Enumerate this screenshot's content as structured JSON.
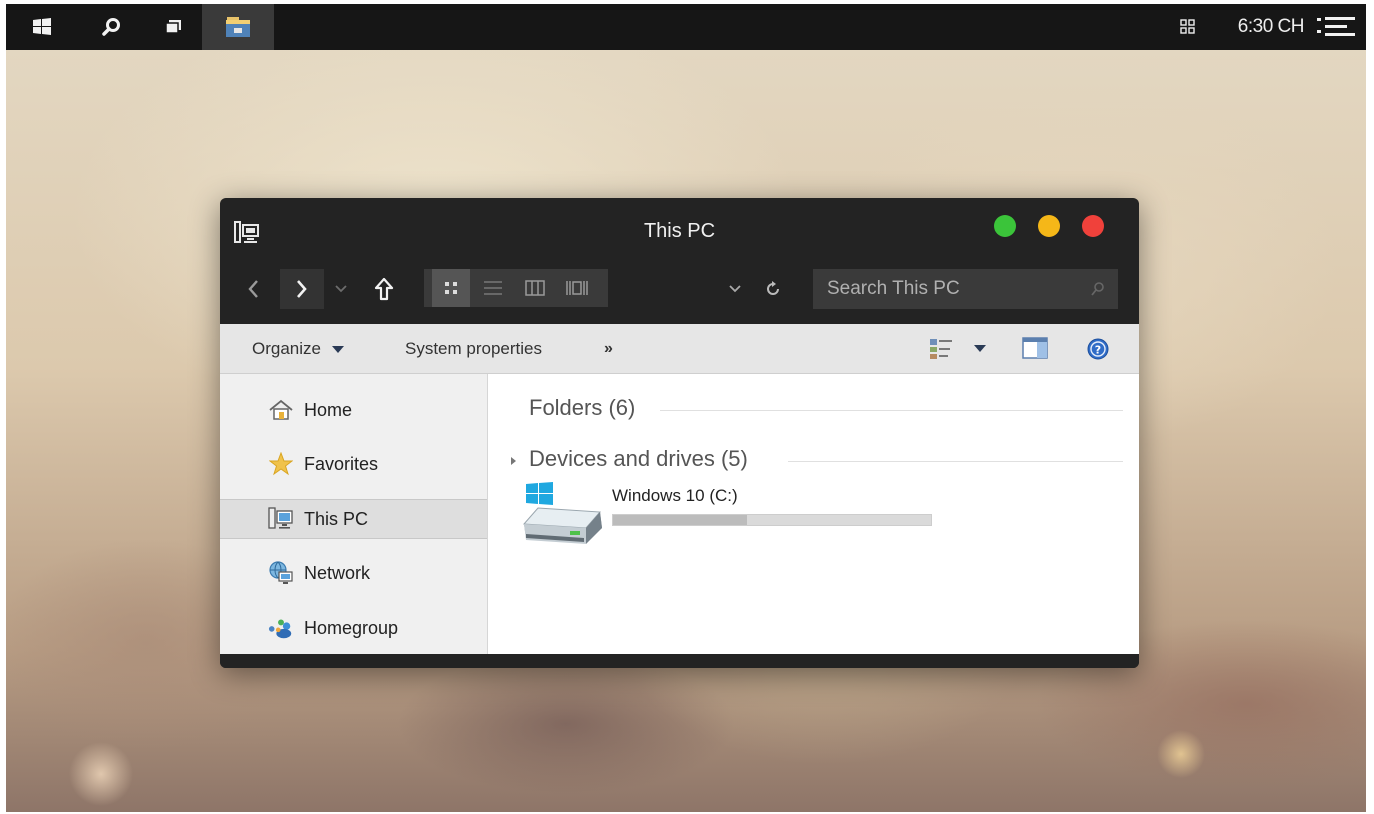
{
  "taskbar": {
    "clock": "6:30 CH",
    "icons": [
      "windows-start-icon",
      "search-icon",
      "task-view-icon",
      "file-explorer-icon",
      "apps-grid-icon",
      "menu-icon"
    ]
  },
  "window": {
    "title": "This PC",
    "traffic_colors": {
      "green": "#3bc43a",
      "yellow": "#f5b718",
      "red": "#f0413b"
    },
    "search": {
      "placeholder": "Search This PC",
      "value": ""
    },
    "commands": {
      "organize": "Organize",
      "system_properties": "System properties",
      "more": "»"
    },
    "sidebar": {
      "items": [
        {
          "label": "Home",
          "icon": "home-icon"
        },
        {
          "label": "Favorites",
          "icon": "star-icon"
        },
        {
          "label": "This PC",
          "icon": "computer-icon",
          "selected": true
        },
        {
          "label": "Network",
          "icon": "network-icon"
        },
        {
          "label": "Homegroup",
          "icon": "homegroup-icon"
        }
      ]
    },
    "content": {
      "groups": [
        {
          "label": "Folders (6)",
          "expanded": true
        },
        {
          "label": "Devices and drives (5)",
          "expanded": false
        }
      ],
      "drive": {
        "name": "Windows 10 (C:)",
        "used_fraction": 0.42
      }
    }
  }
}
